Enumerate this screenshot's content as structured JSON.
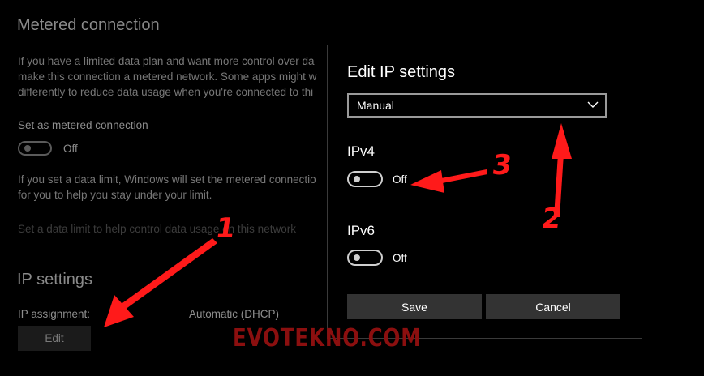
{
  "metered": {
    "heading": "Metered connection",
    "description": [
      "If you have a limited data plan and want more control over da",
      "make this connection a metered network. Some apps might w",
      "differently to reduce data usage when you're connected to thi"
    ],
    "toggle_label": "Set as metered connection",
    "toggle_state": "Off",
    "limit_text": [
      "If you set a data limit, Windows will set the metered connectio",
      "for you to help you stay under your limit."
    ],
    "limit_link": "Set a data limit to help control data usage on this network"
  },
  "ip_settings": {
    "heading": "IP settings",
    "assignment_label": "IP assignment:",
    "assignment_value": "Automatic (DHCP)",
    "edit_label": "Edit"
  },
  "dialog": {
    "title": "Edit IP settings",
    "mode_value": "Manual",
    "ipv4_label": "IPv4",
    "ipv4_state": "Off",
    "ipv6_label": "IPv6",
    "ipv6_state": "Off",
    "save_label": "Save",
    "cancel_label": "Cancel"
  },
  "annotations": {
    "step1": "1",
    "step2": "2",
    "step3": "3",
    "color": "#ff1a1a"
  },
  "watermark": "EVOTEKNO.COM",
  "colors": {
    "background": "#000000",
    "button": "#333333",
    "dialog_border": "#3a3a3a"
  }
}
